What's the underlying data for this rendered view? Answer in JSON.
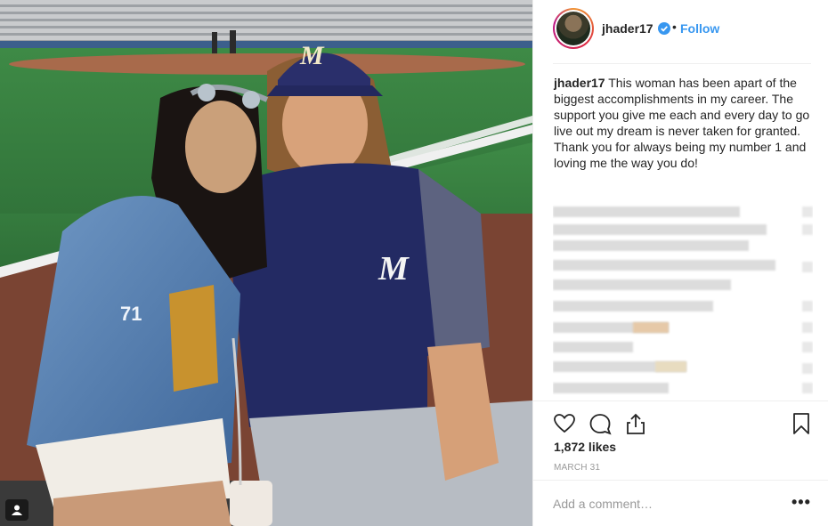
{
  "post": {
    "username": "jhader17",
    "separator": "•",
    "follow_label": "Follow",
    "caption_user": "jhader17",
    "caption_text": "This woman has been apart of the biggest accomplishments in my career. The support you give me each and every day to go live out my dream is never taken for granted. Thank you for always being my number 1 and loving me the way you do!",
    "likes": "1,872 likes",
    "date": "MARCH 31",
    "add_comment_placeholder": "Add a comment…",
    "more_label": "•••"
  },
  "photo": {
    "jacket_patch": "71"
  },
  "icons": {
    "verified": "verified-badge-icon",
    "like": "heart-icon",
    "comment": "comment-bubble-icon",
    "share": "share-upload-icon",
    "save": "bookmark-icon",
    "tag": "user-tag-icon",
    "cap_logo": "M"
  },
  "colors": {
    "link_blue": "#3897f0",
    "text": "#262626",
    "muted": "#999999",
    "border": "#efefef"
  }
}
